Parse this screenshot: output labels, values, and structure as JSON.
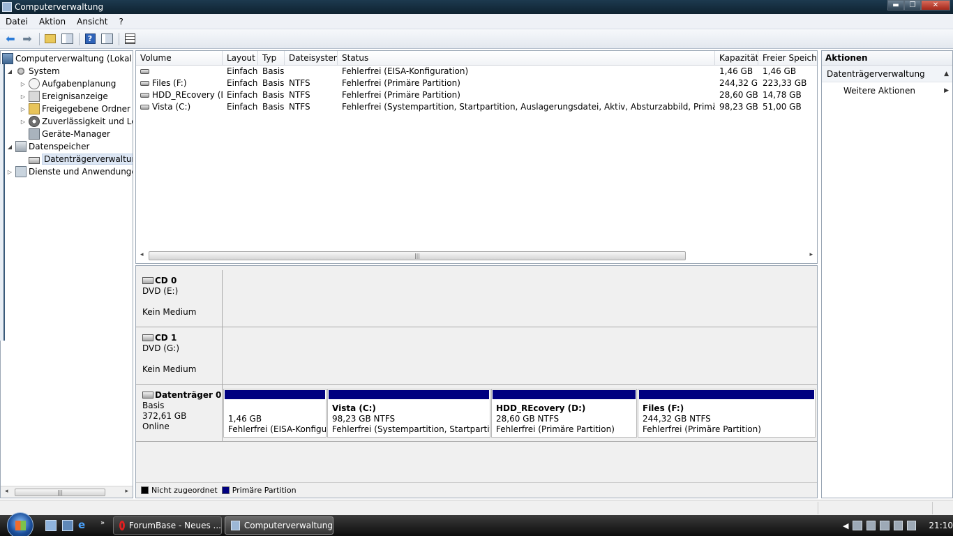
{
  "window": {
    "title": "Computerverwaltung",
    "buttons": {
      "minimize": "▬",
      "maximize": "❐",
      "close": "✕"
    }
  },
  "menu": [
    "Datei",
    "Aktion",
    "Ansicht",
    "?"
  ],
  "toolbar": {
    "icons": [
      "back-icon",
      "forward-icon",
      "folder-up-icon",
      "show-hide-tree-icon",
      "help-icon",
      "show-hide-action-pane-icon",
      "properties-icon"
    ]
  },
  "tree": {
    "items": [
      {
        "label": "Computerverwaltung (Lokal)",
        "icon": "computer-management-icon",
        "expander": ""
      },
      {
        "label": "System",
        "icon": "system-tools-icon",
        "expander": "◢"
      },
      {
        "label": "Aufgabenplanung",
        "icon": "task-scheduler-icon",
        "expander": "▷"
      },
      {
        "label": "Ereignisanzeige",
        "icon": "event-viewer-icon",
        "expander": "▷"
      },
      {
        "label": "Freigegebene Ordner",
        "icon": "shared-folders-icon",
        "expander": "▷"
      },
      {
        "label": "Zuverlässigkeit und Leis",
        "icon": "reliability-icon",
        "expander": "▷"
      },
      {
        "label": "Geräte-Manager",
        "icon": "device-manager-icon",
        "expander": ""
      },
      {
        "label": "Datenspeicher",
        "icon": "storage-icon",
        "expander": "◢"
      },
      {
        "label": "Datenträgerverwaltung",
        "icon": "disk-management-icon",
        "expander": ""
      },
      {
        "label": "Dienste und Anwendungen",
        "icon": "services-icon",
        "expander": "▷"
      }
    ],
    "scrollbar": {
      "left": "◂",
      "right": "▸",
      "grip": "|||"
    }
  },
  "volumes": {
    "columns": [
      "Volume",
      "Layout",
      "Typ",
      "Dateisystem",
      "Status",
      "Kapazität",
      "Freier Speicher"
    ],
    "rows": [
      [
        "",
        "Einfach",
        "Basis",
        "",
        "Fehlerfrei (EISA-Konfiguration)",
        "1,46 GB",
        "1,46 GB"
      ],
      [
        "Files (F:)",
        "Einfach",
        "Basis",
        "NTFS",
        "Fehlerfrei (Primäre Partition)",
        "244,32 GB",
        "223,33 GB"
      ],
      [
        "HDD_REcovery (D:)",
        "Einfach",
        "Basis",
        "NTFS",
        "Fehlerfrei (Primäre Partition)",
        "28,60 GB",
        "14,78 GB"
      ],
      [
        "Vista (C:)",
        "Einfach",
        "Basis",
        "NTFS",
        "Fehlerfrei (Systempartition, Startpartition, Auslagerungsdatei, Aktiv, Absturzabbild, Primäre Partition)",
        "98,23 GB",
        "51,00 GB"
      ]
    ],
    "scrollbar": {
      "left": "◂",
      "right": "▸",
      "grip": "|||"
    }
  },
  "disks": [
    {
      "name": "CD 0",
      "line1": "DVD (E:)",
      "line2": "",
      "line3": "Kein Medium"
    },
    {
      "name": "CD 1",
      "line1": "DVD (G:)",
      "line2": "",
      "line3": "Kein Medium"
    },
    {
      "name": "Datenträger 0",
      "line1": "Basis",
      "line2": "372,61 GB",
      "line3": "Online",
      "partitions": [
        {
          "name": "",
          "size": "1,46 GB",
          "status": "Fehlerfrei (EISA-Konfigura"
        },
        {
          "name": "Vista  (C:)",
          "size": "98,23 GB NTFS",
          "status": "Fehlerfrei (Systempartition, Startpartition,"
        },
        {
          "name": "HDD_REcovery  (D:)",
          "size": "28,60 GB NTFS",
          "status": "Fehlerfrei (Primäre Partition)"
        },
        {
          "name": "Files  (F:)",
          "size": "244,32 GB NTFS",
          "status": "Fehlerfrei (Primäre Partition)"
        }
      ]
    }
  ],
  "legend": [
    {
      "label": "Nicht zugeordnet",
      "color": "#000000"
    },
    {
      "label": "Primäre Partition",
      "color": "#000080"
    }
  ],
  "actions": {
    "header": "Aktionen",
    "section": "Datenträgerverwaltung",
    "section_caret": "▲",
    "item": "Weitere Aktionen",
    "item_caret": "▶"
  },
  "taskbar": {
    "quicklaunch_more": "»",
    "tasks": [
      {
        "label": "ForumBase - Neues ...",
        "icon": "opera-icon"
      },
      {
        "label": "Computerverwaltung",
        "icon": "computer-management-icon"
      }
    ],
    "tray_chevron": "◀",
    "clock": "21:10"
  }
}
